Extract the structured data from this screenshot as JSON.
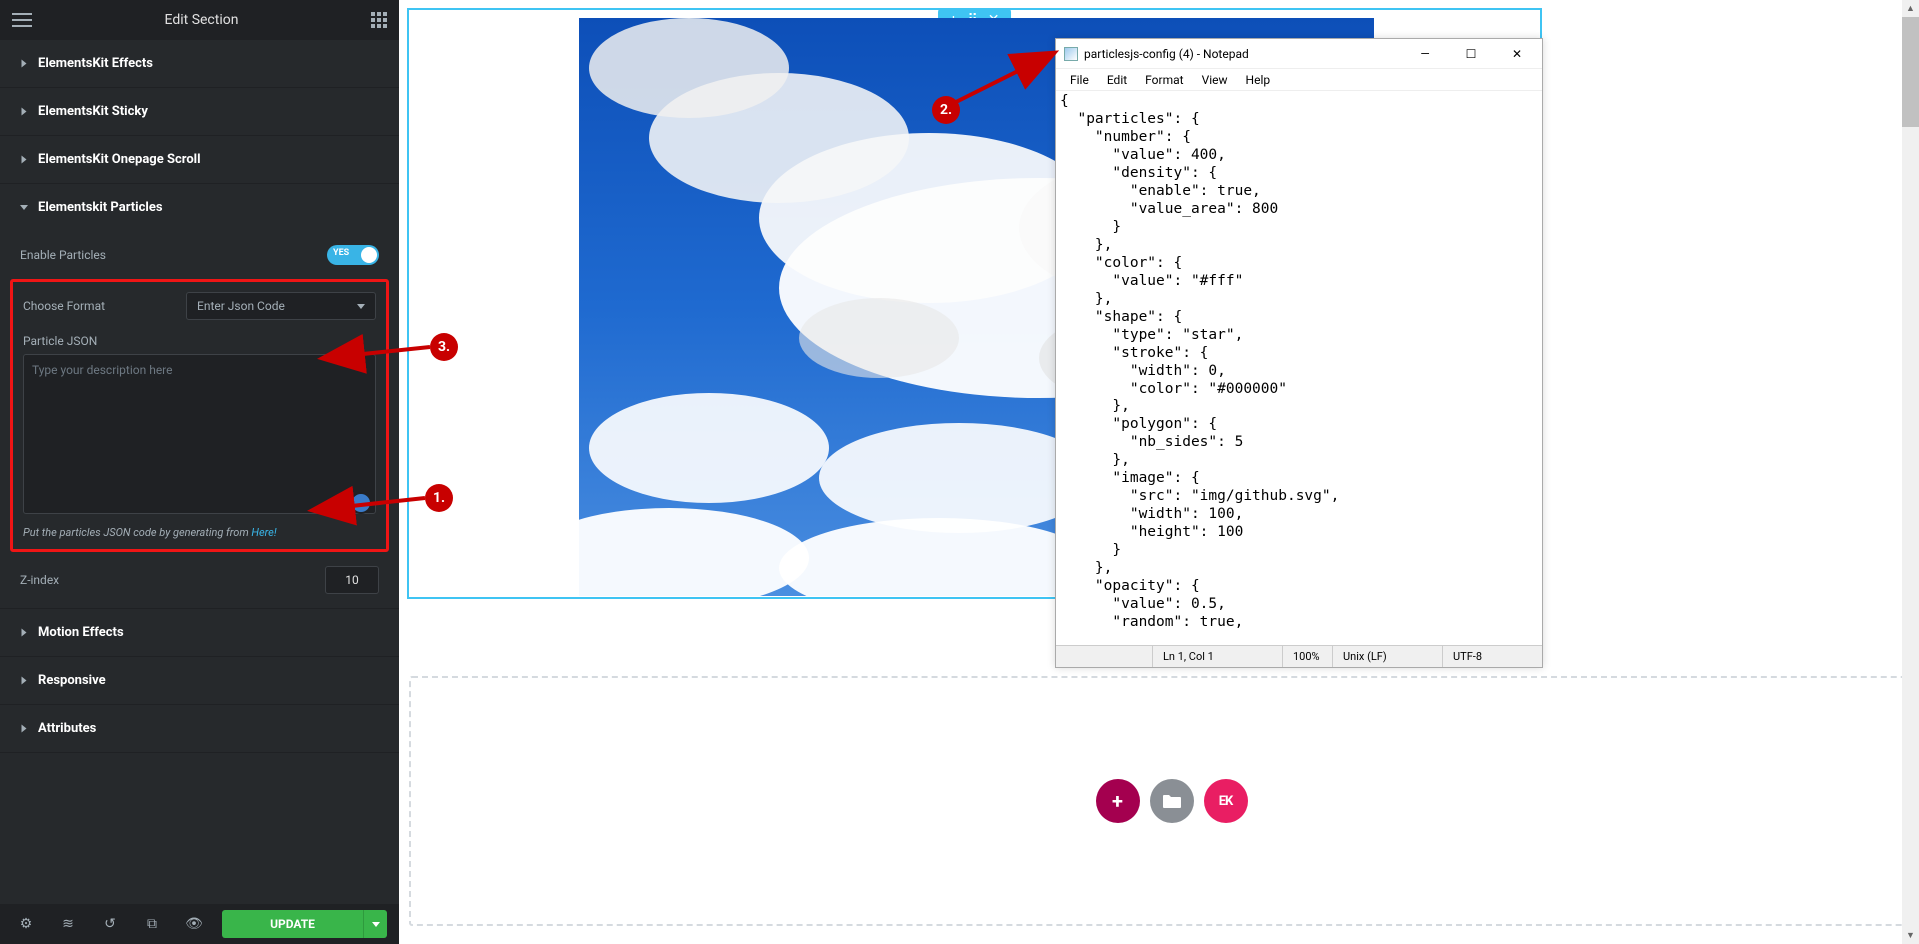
{
  "header": {
    "title": "Edit Section"
  },
  "accordions": {
    "effects": "ElementsKit Effects",
    "sticky": "ElementsKit Sticky",
    "onepage": "ElementsKit Onepage Scroll",
    "particles": "Elementskit Particles",
    "motion": "Motion Effects",
    "responsive": "Responsive",
    "attributes": "Attributes"
  },
  "controls": {
    "enable_label": "Enable Particles",
    "toggle_label": "YES",
    "format_label": "Choose Format",
    "format_value": "Enter Json Code",
    "json_label": "Particle JSON",
    "json_placeholder": "Type your description here",
    "helper_prefix": "Put the particles JSON code by generating from ",
    "helper_link": "Here!",
    "zindex_label": "Z-index",
    "zindex_value": "10"
  },
  "footer": {
    "update": "UPDATE"
  },
  "canvas": {
    "tab_add": "+",
    "tab_grid": "⠿",
    "tab_close": "✕",
    "circle_add": "+",
    "circle_folder": "🗀",
    "circle_ek": "EK"
  },
  "notepad": {
    "title": "particlesjs-config (4) - Notepad",
    "menus": [
      "File",
      "Edit",
      "Format",
      "View",
      "Help"
    ],
    "content": "{\n  \"particles\": {\n    \"number\": {\n      \"value\": 400,\n      \"density\": {\n        \"enable\": true,\n        \"value_area\": 800\n      }\n    },\n    \"color\": {\n      \"value\": \"#fff\"\n    },\n    \"shape\": {\n      \"type\": \"star\",\n      \"stroke\": {\n        \"width\": 0,\n        \"color\": \"#000000\"\n      },\n      \"polygon\": {\n        \"nb_sides\": 5\n      },\n      \"image\": {\n        \"src\": \"img/github.svg\",\n        \"width\": 100,\n        \"height\": 100\n      }\n    },\n    \"opacity\": {\n      \"value\": 0.5,\n      \"random\": true,",
    "status": {
      "pos": "Ln 1, Col 1",
      "zoom": "100%",
      "eol": "Unix (LF)",
      "enc": "UTF-8"
    }
  },
  "annotations": {
    "n1": "1.",
    "n2": "2.",
    "n3": "3."
  }
}
